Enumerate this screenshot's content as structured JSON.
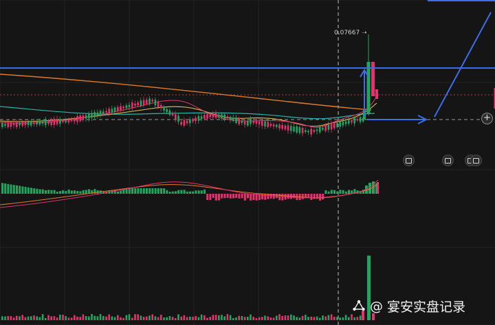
{
  "chart": {
    "peak_label": "0.07667",
    "colors": {
      "background": "#151515",
      "up": "#1fa760",
      "down": "#e8306f",
      "drawing_blue": "#3d6ee8",
      "ma_orange": "#e07a2a",
      "ma_yellow": "#e6c34a",
      "ma_teal": "#2bb5a8",
      "ma_red": "#e8306f",
      "price_line": "#c23a3a"
    }
  },
  "toolbar": {
    "icons": [
      "drawing-tool-icon",
      "drawing-tool-icon",
      "drawing-tool-icon"
    ],
    "plus_label": "+"
  },
  "watermark": {
    "at": "@",
    "text": "宴安实盘记录"
  }
}
